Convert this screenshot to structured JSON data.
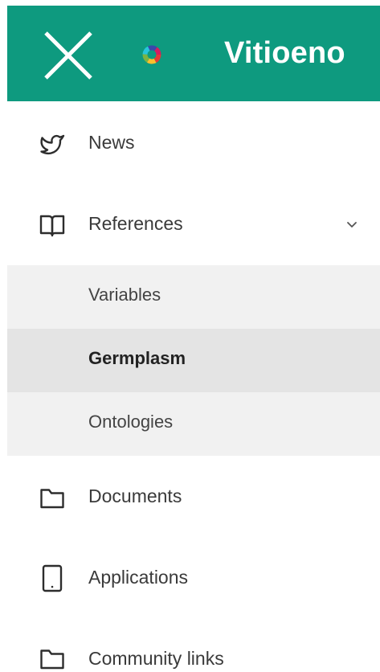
{
  "header": {
    "title": "Vitioeno",
    "close_icon": "close-icon",
    "logo_icon": "multicolor-ring-logo",
    "background_color": "#0e9a7f"
  },
  "menu": {
    "news": {
      "label": "News",
      "icon": "twitter-bird-icon"
    },
    "references": {
      "label": "References",
      "icon": "open-book-icon",
      "expanded": true,
      "expand_icon": "chevron-down-icon",
      "children": [
        {
          "label": "Variables",
          "active": false
        },
        {
          "label": "Germplasm",
          "active": true
        },
        {
          "label": "Ontologies",
          "active": false
        }
      ]
    },
    "documents": {
      "label": "Documents",
      "icon": "folder-icon"
    },
    "applications": {
      "label": "Applications",
      "icon": "tablet-icon"
    },
    "community_links": {
      "label": "Community links",
      "icon": "folder-icon"
    }
  }
}
